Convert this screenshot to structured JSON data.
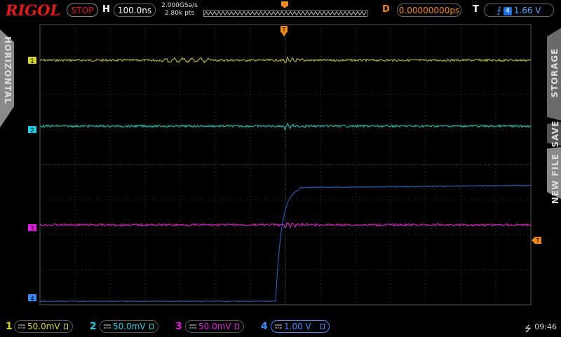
{
  "header": {
    "logo": "RIGOL",
    "run_state": "STOP",
    "h_label": "H",
    "timebase": "100.0ns",
    "sample_rate": "2.000GSa/s",
    "points": "2.80k pts",
    "delay_label": "D",
    "delay": "0.00000000ps",
    "trigger_label": "T",
    "trigger_source": "4",
    "trigger_level": "1.66 V",
    "trigger_marker": "T"
  },
  "sidebar_left": {
    "tab": "HORIZONTAL"
  },
  "sidebar_right": {
    "tabs": [
      "STORAGE",
      "SAVE",
      "NEW FILE"
    ]
  },
  "channels": [
    {
      "num": "1",
      "scale": "50.0mV",
      "color": "#d6d62a",
      "trace_color": "#a8a832"
    },
    {
      "num": "2",
      "scale": "50.0mV",
      "color": "#1ecfe0",
      "trace_color": "#2aa89a"
    },
    {
      "num": "3",
      "scale": "50.0mV",
      "color": "#e01ee0",
      "trace_color": "#b82aa8"
    },
    {
      "num": "4",
      "scale": "1.00 V",
      "color": "#3a8cff",
      "trace_color": "#2a5aa8"
    }
  ],
  "status": {
    "usb_icon": "usb-icon",
    "clock": "09:46"
  },
  "colors": {
    "accent_orange": "#f08a1c",
    "stop_red": "#e31b1b",
    "grid": "#3a3a3a"
  }
}
